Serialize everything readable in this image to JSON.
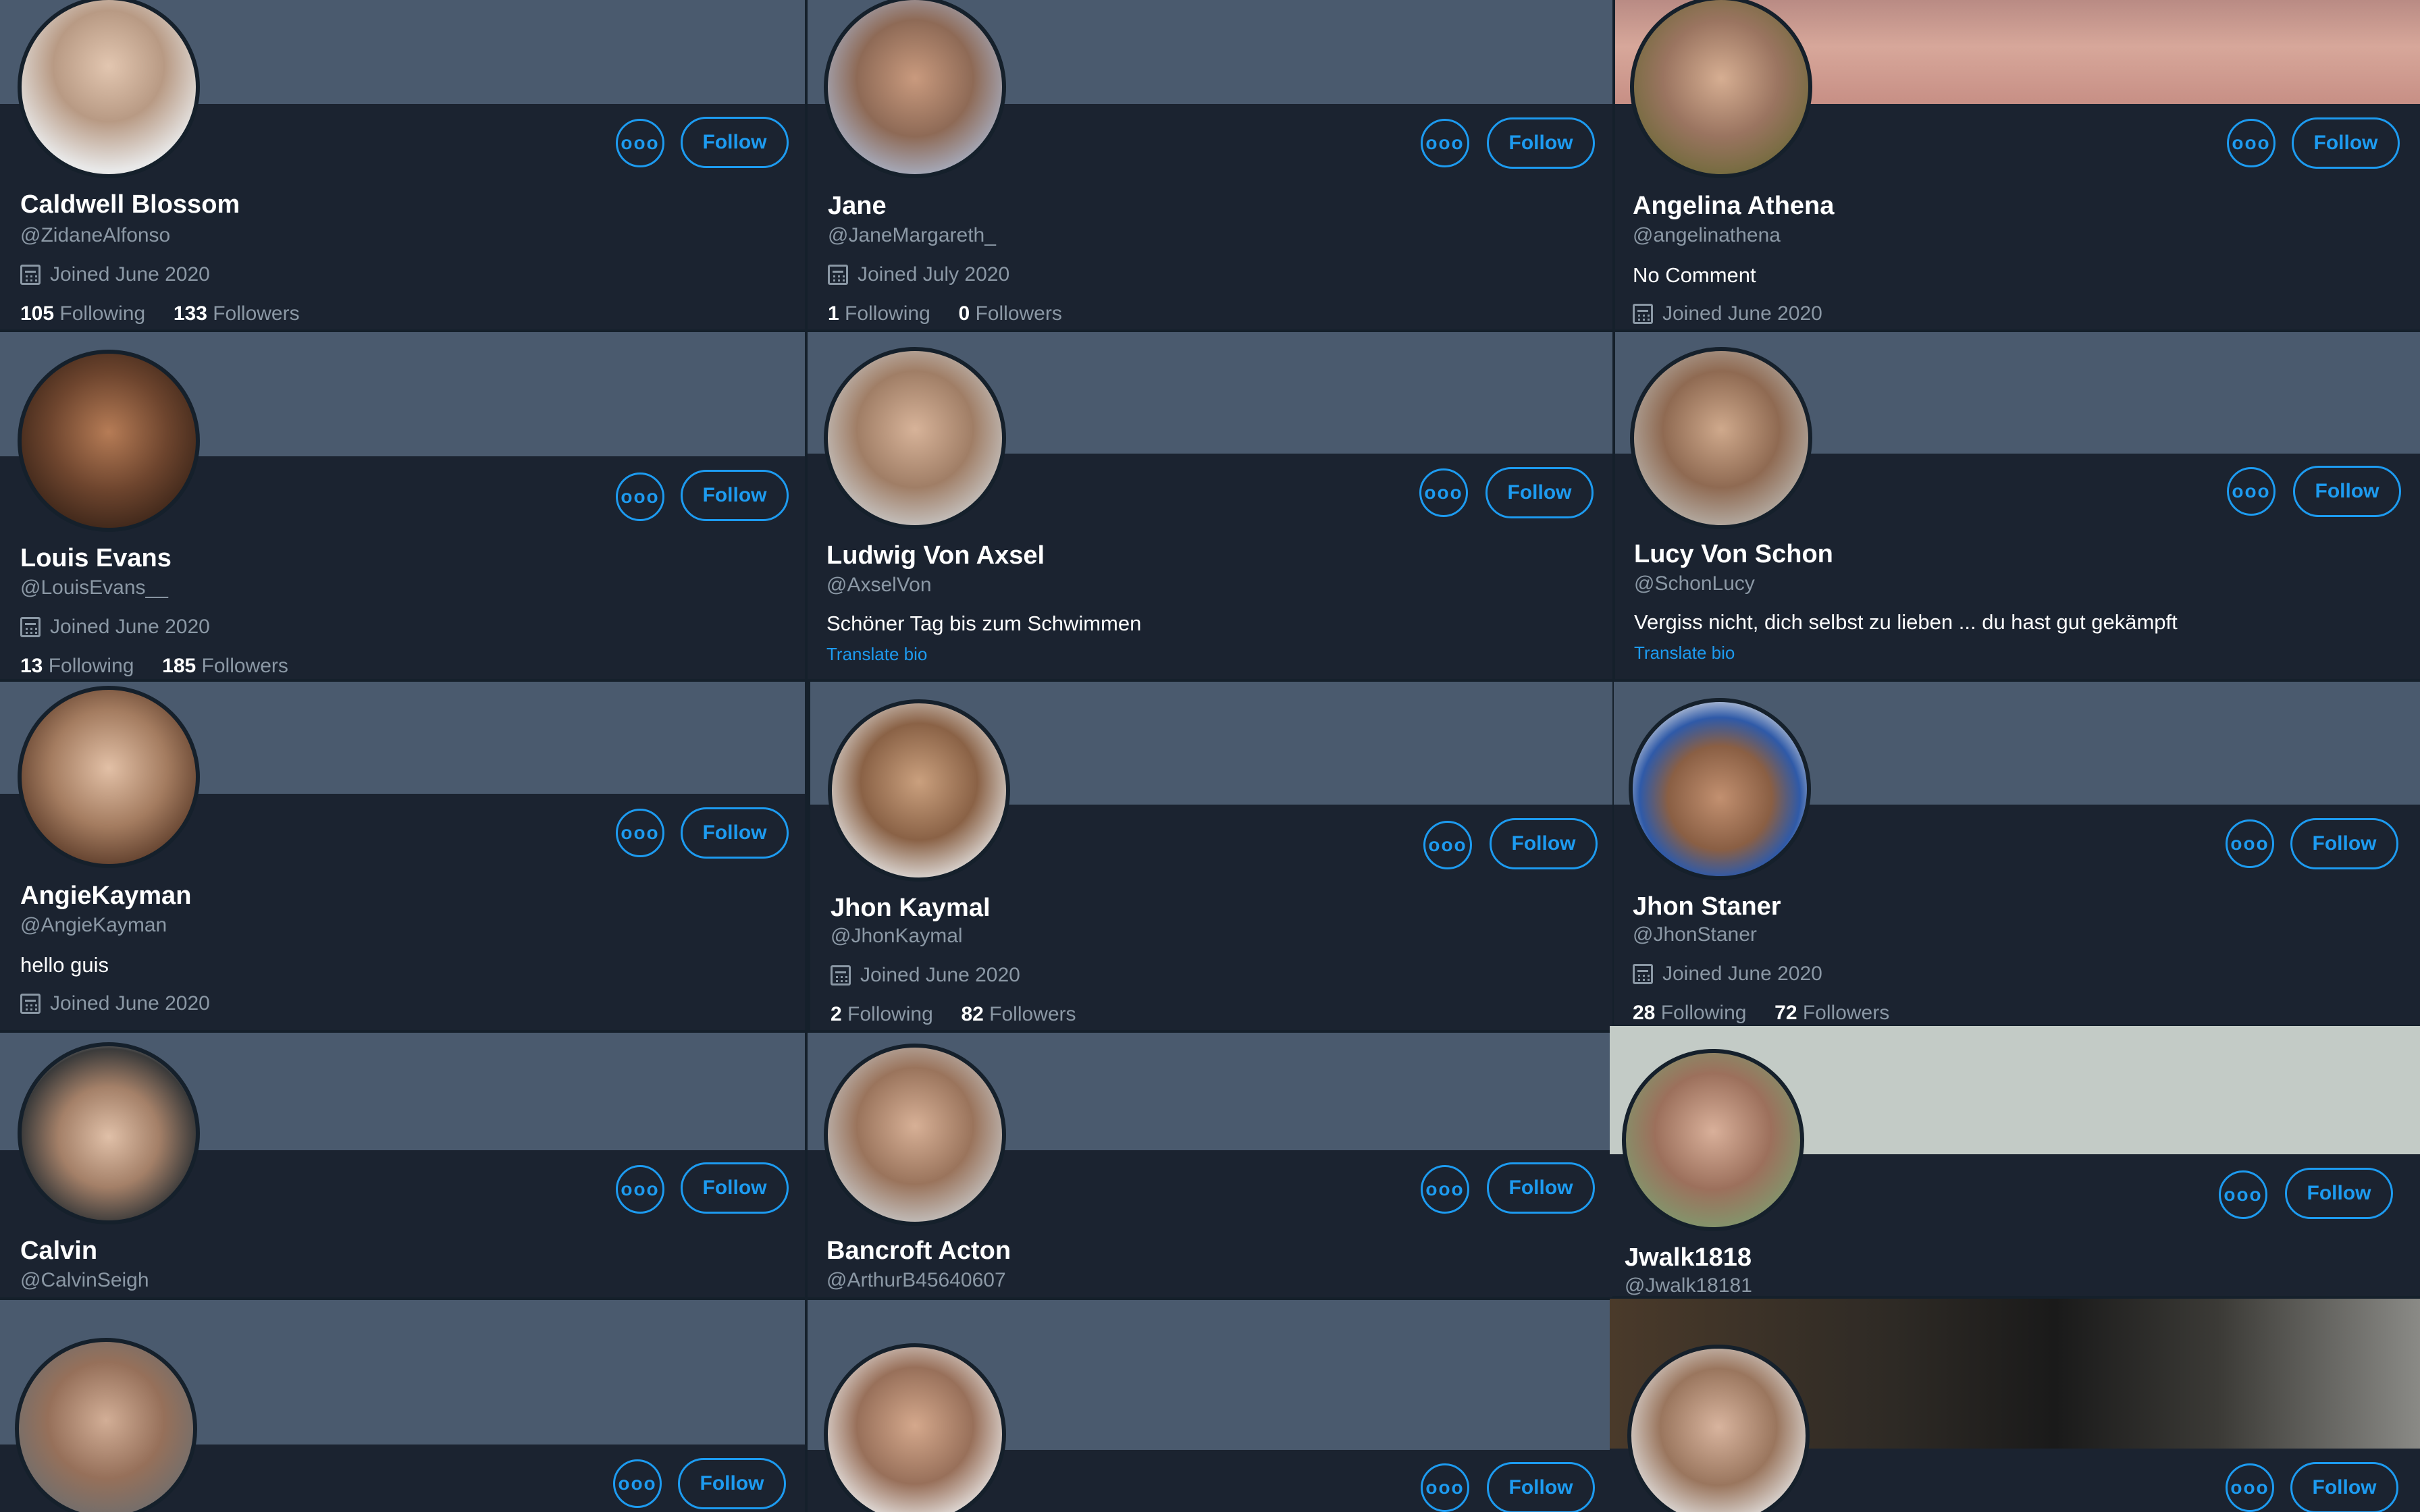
{
  "ui": {
    "follow_label": "Follow",
    "more_label": "ooo",
    "translate_label": "Translate bio"
  },
  "profiles": [
    {
      "name": "Caldwell Blossom",
      "handle": "@ZidaneAlfonso",
      "joined": "Joined June 2020",
      "following": "105",
      "following_label": "Following",
      "followers": "133",
      "followers_label": "Followers"
    },
    {
      "name": "Jane",
      "handle": "@JaneMargareth_",
      "joined": "Joined July 2020",
      "following": "1",
      "following_label": "Following",
      "followers": "0",
      "followers_label": "Followers"
    },
    {
      "name": "Angelina Athena",
      "handle": "@angelinathena",
      "bio": "No Comment",
      "joined": "Joined June 2020"
    },
    {
      "name": "Louis Evans",
      "handle": "@LouisEvans__",
      "joined": "Joined June 2020",
      "following": "13",
      "following_label": "Following",
      "followers": "185",
      "followers_label": "Followers"
    },
    {
      "name": "Ludwig Von Axsel",
      "handle": "@AxselVon",
      "bio": "Schöner Tag bis zum Schwimmen"
    },
    {
      "name": "Lucy Von Schon",
      "handle": "@SchonLucy",
      "bio": "Vergiss nicht, dich selbst zu lieben ... du hast gut gekämpft"
    },
    {
      "name": "AngieKayman",
      "handle": "@AngieKayman",
      "bio": "hello guis",
      "joined": "Joined June 2020"
    },
    {
      "name": "Jhon Kaymal",
      "handle": "@JhonKaymal",
      "joined": "Joined June 2020",
      "following": "2",
      "following_label": "Following",
      "followers": "82",
      "followers_label": "Followers"
    },
    {
      "name": "Jhon Staner",
      "handle": "@JhonStaner",
      "joined": "Joined June 2020",
      "following": "28",
      "following_label": "Following",
      "followers": "72",
      "followers_label": "Followers"
    },
    {
      "name": "Calvin",
      "handle": "@CalvinSeigh"
    },
    {
      "name": "Bancroft Acton",
      "handle": "@ArthurB45640607"
    },
    {
      "name": "Jwalk1818",
      "handle": "@Jwalk18181"
    },
    {
      "name": "",
      "handle": ""
    },
    {
      "name": "",
      "handle": ""
    },
    {
      "name": "",
      "handle": ""
    }
  ]
}
